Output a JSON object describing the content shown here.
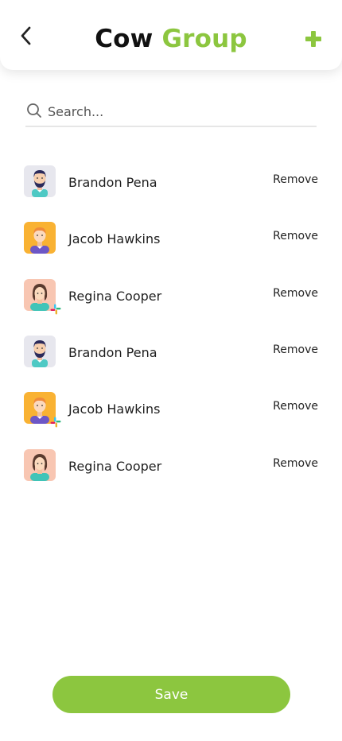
{
  "header": {
    "title_part1": "Cow",
    "title_part2": "Group",
    "back_icon": "chevron-left-icon",
    "add_icon": "plus-icon"
  },
  "search": {
    "placeholder": "Search...",
    "value": ""
  },
  "members": [
    {
      "name": "Brandon Pena",
      "avatar": "man-beard",
      "badge": false,
      "action": "Remove"
    },
    {
      "name": "Jacob Hawkins",
      "avatar": "man-orange",
      "badge": false,
      "action": "Remove"
    },
    {
      "name": "Regina Cooper",
      "avatar": "woman",
      "badge": true,
      "action": "Remove"
    },
    {
      "name": "Brandon Pena",
      "avatar": "man-beard",
      "badge": false,
      "action": "Remove"
    },
    {
      "name": "Jacob Hawkins",
      "avatar": "man-orange",
      "badge": true,
      "action": "Remove"
    },
    {
      "name": "Regina Cooper",
      "avatar": "woman",
      "badge": false,
      "action": "Remove"
    }
  ],
  "footer": {
    "save_label": "Save"
  },
  "colors": {
    "accent": "#8cc63f",
    "text": "#1f1f1f"
  }
}
